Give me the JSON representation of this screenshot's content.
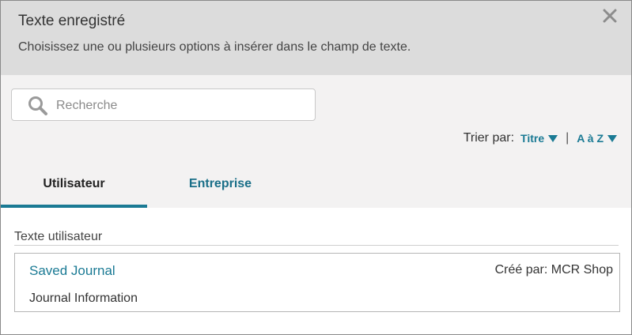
{
  "dialog": {
    "title": "Texte enregistré",
    "subtitle": "Choisissez une ou plusieurs options à insérer dans le champ de texte.",
    "close_icon": "close-icon"
  },
  "search": {
    "placeholder": "Recherche",
    "value": "",
    "icon": "search-icon"
  },
  "sort": {
    "label": "Trier par:",
    "field": "Titre",
    "separator": "|",
    "order": "A à Z"
  },
  "tabs": [
    {
      "label": "Utilisateur",
      "active": true
    },
    {
      "label": "Entreprise",
      "active": false
    }
  ],
  "section": {
    "label": "Texte utilisateur"
  },
  "items": [
    {
      "name": "Saved Journal",
      "created_by": "Créé par: MCR Shop",
      "description": "Journal Information"
    }
  ],
  "colors": {
    "accent": "#1a7a94",
    "header_bg": "#dcdcdc",
    "toolbar_bg": "#f3f2f2"
  }
}
